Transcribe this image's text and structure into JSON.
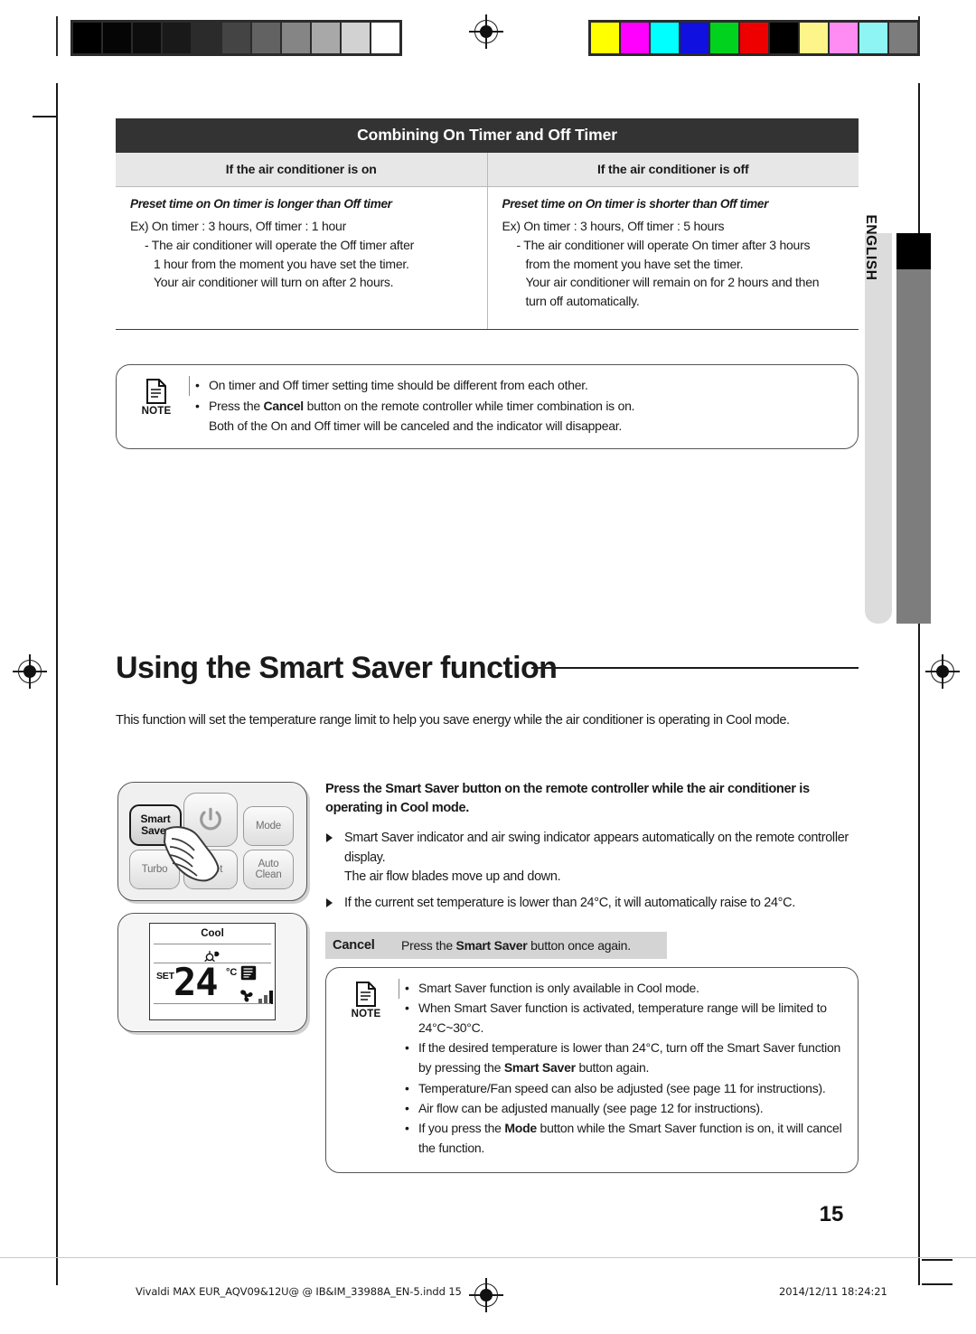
{
  "calibration": {
    "gray_patches": [
      "#000000",
      "#050505",
      "#0d0d0d",
      "#191919",
      "#2b2b2b",
      "#444444",
      "#626262",
      "#858585",
      "#a8a8a8",
      "#d2d2d2",
      "#ffffff"
    ],
    "color_patches": [
      "#ffff00",
      "#ff00ff",
      "#00ffff",
      "#1010e0",
      "#00d21e",
      "#ee0000",
      "#000000",
      "#fdf58a",
      "#ff8cf3",
      "#8ef4f4",
      "#7c7c7c"
    ]
  },
  "side_tab": {
    "language": "ENGLISH"
  },
  "timer_table": {
    "title": "Combining On Timer and Off Timer",
    "columns": [
      {
        "header": "If the air conditioner is on",
        "subtitle": "Preset time on On timer is longer than Off timer",
        "example": "Ex) On timer : 3 hours, Off timer : 1 hour",
        "detail_lead": "- The air conditioner will operate the Off timer after",
        "detail_lines": [
          "1 hour from the moment you have set the timer.",
          "Your air conditioner will turn on after 2 hours."
        ]
      },
      {
        "header": "If the air conditioner is off",
        "subtitle": "Preset time on On timer is shorter than Off timer",
        "example": "Ex) On timer : 3 hours, Off timer : 5 hours",
        "detail_lead": "- The air conditioner will operate On timer after 3 hours",
        "detail_lines": [
          "from the moment you have set the timer.",
          "Your air conditioner will remain on for 2 hours and then",
          "turn off automatically."
        ]
      }
    ]
  },
  "note_top": {
    "label": "NOTE",
    "items": [
      {
        "text": "On timer and Off timer setting time should be different from each other."
      },
      {
        "prefix": "Press the ",
        "bold": "Cancel",
        "suffix": " button on the remote controller while timer combination is on.",
        "continuation": "Both of the On and Off timer will be canceled and the indicator will disappear."
      }
    ]
  },
  "section": {
    "title": "Using the Smart Saver function",
    "intro": "This function will set the temperature range limit to help you save energy while the air conditioner is operating in Cool mode."
  },
  "remote": {
    "keys": {
      "smart_saver": "Smart\nSaver",
      "smart_saver_line1": "Smart",
      "smart_saver_line2": "Saver",
      "power": "power-icon",
      "mode": "Mode",
      "turbo": "Turbo",
      "quiet": "Quiet",
      "auto_clean_line1": "Auto",
      "auto_clean_line2": "Clean"
    },
    "display": {
      "mode": "Cool",
      "set_label": "SET",
      "temperature": "24",
      "unit": "°C",
      "saver_icon": "smart-saver-icon",
      "swing_icon": "air-swing-icon",
      "fan_icon": "fan-icon",
      "fan_level": 3
    }
  },
  "instructions": {
    "lead_prefix": "Press the ",
    "lead_bold": "Smart Saver",
    "lead_suffix": " button on the remote controller while the air conditioner is operating in Cool mode.",
    "items": [
      {
        "text": "Smart Saver indicator and air swing indicator appears automatically on the remote controller display.",
        "continuation": "The air flow blades move up and down."
      },
      {
        "text": "If the current set temperature is lower than 24°C, it will automatically raise to 24°C."
      }
    ]
  },
  "cancel": {
    "label": "Cancel",
    "prefix": "Press the ",
    "bold": "Smart Saver",
    "suffix": " button once again."
  },
  "note_bottom": {
    "label": "NOTE",
    "items": [
      {
        "text": "Smart Saver function is only available in Cool mode."
      },
      {
        "text": "When Smart Saver function is activated, temperature range will be limited to",
        "continuation": "24°C~30°C."
      },
      {
        "prefix": "If the desired temperature is lower than 24°C, turn off the Smart Saver function",
        "continuation_prefix": "by pressing the ",
        "continuation_bold": "Smart Saver",
        "continuation_suffix": " button again."
      },
      {
        "text": "Temperature/Fan speed can also be adjusted (see page 11 for instructions)."
      },
      {
        "text": "Air flow can be adjusted manually (see page 12 for instructions)."
      },
      {
        "prefix": "If you press the ",
        "bold": "Mode",
        "suffix": " button while the Smart Saver function is on, it will cancel",
        "continuation": "the function."
      }
    ]
  },
  "page_number": "15",
  "footer": {
    "left": "Vivaldi MAX EUR_AQV09&12U@ @  IB&IM_33988A_EN-5.indd   15",
    "right": "2014/12/11   18:24:21"
  }
}
